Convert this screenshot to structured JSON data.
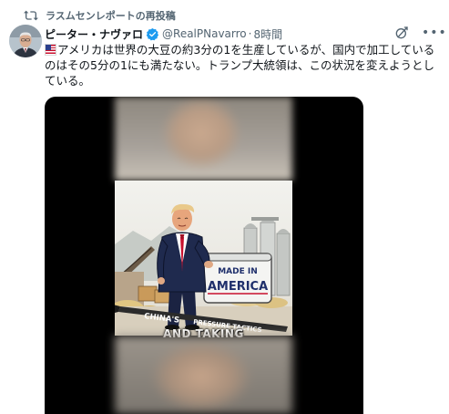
{
  "repost": {
    "label": "ラスムセンレポートの再投稿"
  },
  "author": {
    "display_name": "ピーター・ナヴァロ",
    "handle": "@RealPNavarro",
    "separator": "·",
    "time": "8時間"
  },
  "tweet": {
    "text": "アメリカは世界の大豆の約3分の1を生産しているが、国内で加工しているのはその5分の1にも満たない。トランプ大統領は、この状況を変えようとしている。"
  },
  "media": {
    "sign_line1": "MADE IN",
    "sign_line2": "AMERICA",
    "bat_text_1": "CHINA'S",
    "bat_text_2": "PRESSURE TACTICS",
    "caption": "AND TAKING"
  },
  "colors": {
    "verified": "#1d9bf0",
    "secondary_text": "#536471",
    "primary_text": "#0f1419",
    "tie": "#c8102e",
    "sign_text": "#1f2f6b"
  },
  "icons": {
    "repost": "repost-icon",
    "verified": "verified-badge-icon",
    "grok": "grok-icon",
    "more": "more-icon",
    "flag": "us-flag-icon"
  }
}
